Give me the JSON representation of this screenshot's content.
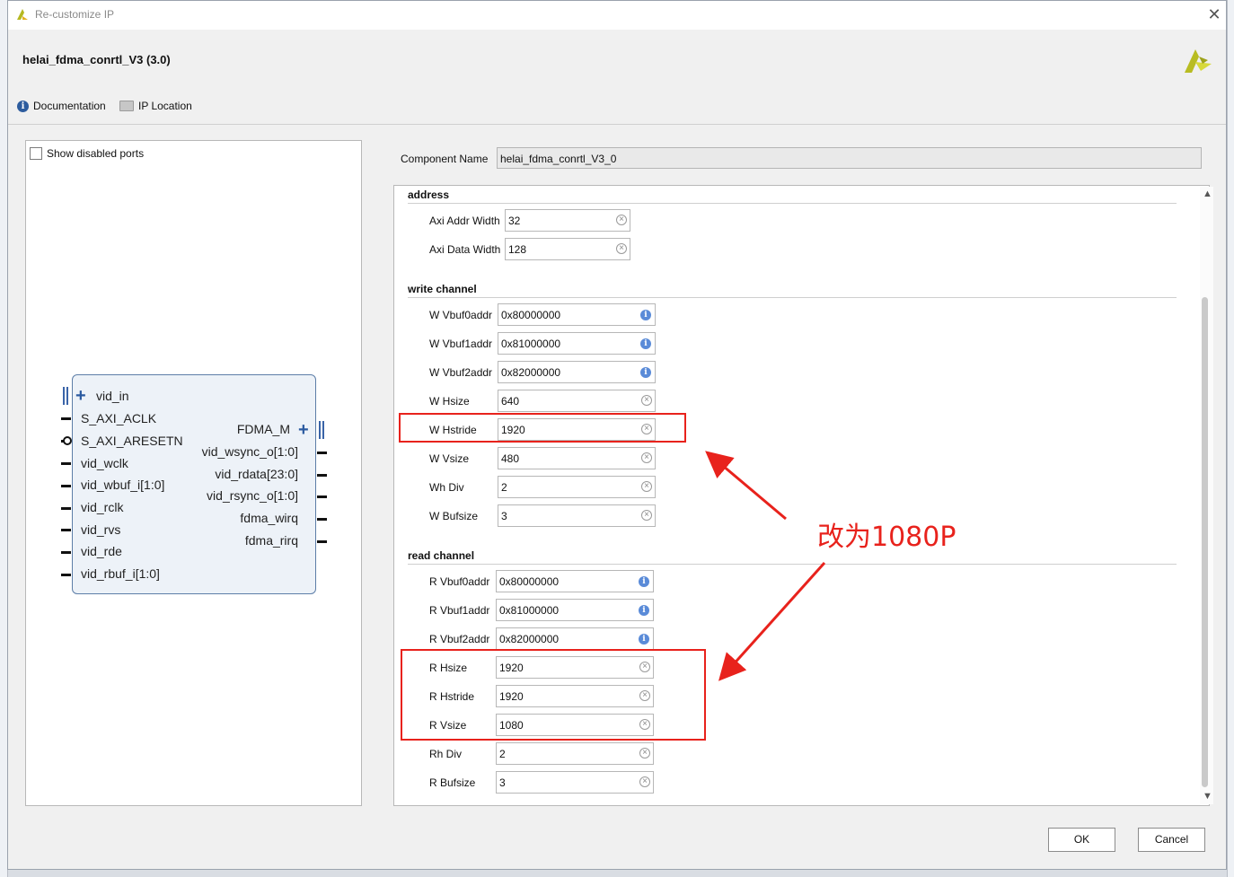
{
  "window": {
    "title": "Re-customize IP",
    "close_glyph": "✕"
  },
  "header": {
    "ip_title": "helai_fdma_conrtl_V3 (3.0)",
    "links": {
      "documentation": "Documentation",
      "ip_location": "IP Location"
    }
  },
  "left_panel": {
    "show_disabled_ports": "Show disabled ports",
    "show_disabled_checked": false,
    "block": {
      "left_ports": [
        "vid_in",
        "S_AXI_ACLK",
        "S_AXI_ARESETN",
        "vid_wclk",
        "vid_wbuf_i[1:0]",
        "vid_rclk",
        "vid_rvs",
        "vid_rde",
        "vid_rbuf_i[1:0]"
      ],
      "right_ports": [
        "FDMA_M",
        "vid_wsync_o[1:0]",
        "vid_rdata[23:0]",
        "vid_rsync_o[1:0]",
        "fdma_wirq",
        "fdma_rirq"
      ]
    }
  },
  "component": {
    "label": "Component Name",
    "value": "helai_fdma_conrtl_V3_0"
  },
  "sections": {
    "address": {
      "title": "address",
      "params": [
        {
          "label": "Axi Addr Width",
          "value": "32",
          "icon": "clear-icon"
        },
        {
          "label": "Axi Data Width",
          "value": "128",
          "icon": "clear-icon"
        }
      ]
    },
    "write": {
      "title": "write channel",
      "params": [
        {
          "label": "W Vbuf0addr",
          "value": "0x80000000",
          "icon": "info-icon"
        },
        {
          "label": "W Vbuf1addr",
          "value": "0x81000000",
          "icon": "info-icon"
        },
        {
          "label": "W Vbuf2addr",
          "value": "0x82000000",
          "icon": "info-icon"
        },
        {
          "label": "W Hsize",
          "value": "640",
          "icon": "clear-icon"
        },
        {
          "label": "W Hstride",
          "value": "1920",
          "icon": "clear-icon"
        },
        {
          "label": "W Vsize",
          "value": "480",
          "icon": "clear-icon"
        },
        {
          "label": "Wh Div",
          "value": "2",
          "icon": "clear-icon"
        },
        {
          "label": "W Bufsize",
          "value": "3",
          "icon": "clear-icon"
        }
      ]
    },
    "read": {
      "title": "read channel",
      "params": [
        {
          "label": "R Vbuf0addr",
          "value": "0x80000000",
          "icon": "info-icon"
        },
        {
          "label": "R Vbuf1addr",
          "value": "0x81000000",
          "icon": "info-icon"
        },
        {
          "label": "R Vbuf2addr",
          "value": "0x82000000",
          "icon": "info-icon"
        },
        {
          "label": "R Hsize",
          "value": "1920",
          "icon": "clear-icon"
        },
        {
          "label": "R Hstride",
          "value": "1920",
          "icon": "clear-icon"
        },
        {
          "label": "R Vsize",
          "value": "1080",
          "icon": "clear-icon"
        },
        {
          "label": "Rh Div",
          "value": "2",
          "icon": "clear-icon"
        },
        {
          "label": "R Bufsize",
          "value": "3",
          "icon": "clear-icon"
        }
      ]
    }
  },
  "annotation": {
    "text": "改为1080P",
    "color": "#e8221c"
  },
  "buttons": {
    "ok": "OK",
    "cancel": "Cancel"
  }
}
